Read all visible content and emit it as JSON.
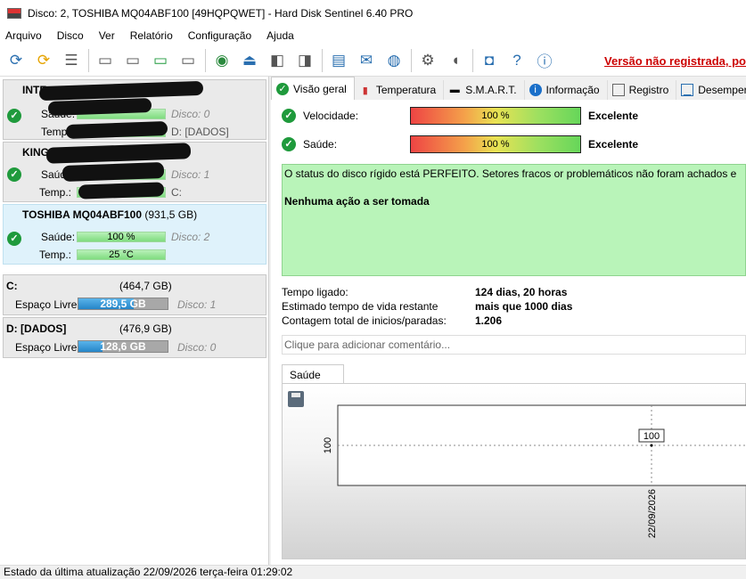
{
  "window": {
    "title": "Disco: 2, TOSHIBA MQ04ABF100 [49HQPQWET]  -  Hard Disk Sentinel 6.40 PRO"
  },
  "menu": [
    "Arquivo",
    "Disco",
    "Ver",
    "Relatório",
    "Configuração",
    "Ajuda"
  ],
  "promo": "Versão não registrada, po",
  "disks": [
    {
      "title": "INTE",
      "size": "",
      "health_label": "Saúde:",
      "health": "",
      "disk_no": "Disco: 0",
      "temp_label": "Temp.:",
      "temp": "",
      "drive": "D: [DADOS]"
    },
    {
      "title": "KING",
      "size": "",
      "health_label": "Saúde:",
      "health": "",
      "disk_no": "Disco: 1",
      "temp_label": "Temp.:",
      "temp": "",
      "drive": "C:"
    },
    {
      "title": "TOSHIBA MQ04ABF100",
      "size": "(931,5 GB)",
      "health_label": "Saúde:",
      "health": "100 %",
      "disk_no": "Disco: 2",
      "temp_label": "Temp.:",
      "temp": "25 °C",
      "drive": ""
    }
  ],
  "volumes": [
    {
      "name": "C:",
      "size": "(464,7 GB)",
      "free_label": "Espaço Livre",
      "free": "289,5 GB",
      "free_fraction": 0.623,
      "disk_no": "Disco: 1"
    },
    {
      "name": "D: [DADOS]",
      "size": "(476,9 GB)",
      "free_label": "Espaço Livre",
      "free": "128,6 GB",
      "free_fraction": 0.27,
      "disk_no": "Disco: 0"
    }
  ],
  "tabs": [
    {
      "label": "Visão geral",
      "icon": "check-icon"
    },
    {
      "label": "Temperatura",
      "icon": "thermometer-icon"
    },
    {
      "label": "S.M.A.R.T.",
      "icon": "smart-icon"
    },
    {
      "label": "Informação",
      "icon": "info-icon"
    },
    {
      "label": "Registro",
      "icon": "log-icon"
    },
    {
      "label": "Desemper",
      "icon": "performance-icon"
    }
  ],
  "overview": {
    "speed": {
      "label": "Velocidade:",
      "value": "100 %",
      "verdict": "Excelente"
    },
    "health": {
      "label": "Saúde:",
      "value": "100 %",
      "verdict": "Excelente"
    },
    "status_text": "O status do disco rígido está PERFEITO. Setores fracos or problemáticos não foram achados e",
    "action": "Nenhuma ação a ser tomada",
    "info": [
      {
        "label": "Tempo ligado:",
        "value": "124 dias, 20 horas"
      },
      {
        "label": "Estimado tempo de vida restante",
        "value": "mais que 1000 dias"
      },
      {
        "label": "Contagem total de inicios/paradas:",
        "value": "1.206"
      }
    ],
    "comment_placeholder": "Clique para adicionar  comentário...",
    "chart_tab": "Saúde (%)"
  },
  "chart_data": {
    "type": "line",
    "x": [
      "22/09/2026"
    ],
    "series": [
      {
        "values": [
          100
        ]
      }
    ],
    "y_ticks": [
      "100"
    ]
  },
  "statusbar": "Estado da última atualização 22/09/2026 terça-feira 01:29:02"
}
